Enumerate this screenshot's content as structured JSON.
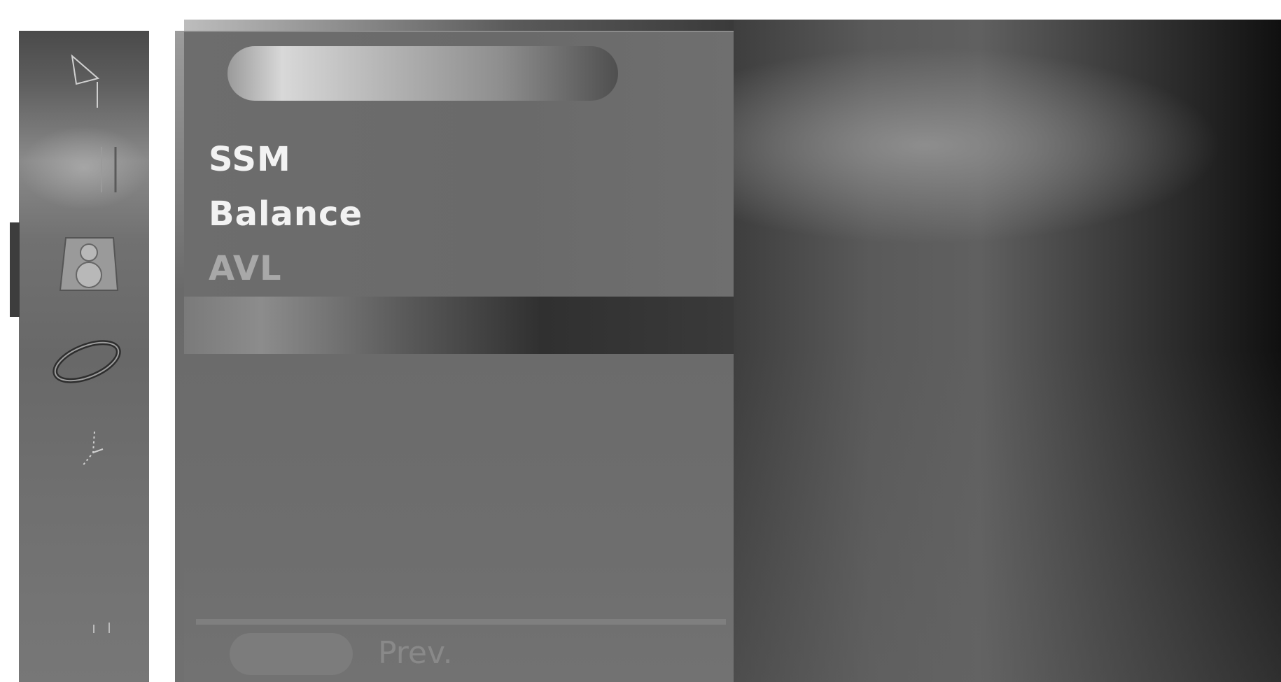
{
  "menu": {
    "title": "",
    "items": [
      {
        "label": "SSM"
      },
      {
        "label": "Balance"
      },
      {
        "label": "AVL"
      }
    ]
  },
  "footer": {
    "prev_label": "Prev."
  },
  "rail": {
    "icons": [
      "station-icon",
      "picture-icon",
      "audio-icon",
      "time-icon",
      "option-icon",
      "lock-icon"
    ],
    "active": "audio-icon"
  },
  "colors": {
    "panel": "#6d6d6d",
    "text_active": "#f2f2f2",
    "text_dim": "#a8a8a8"
  }
}
